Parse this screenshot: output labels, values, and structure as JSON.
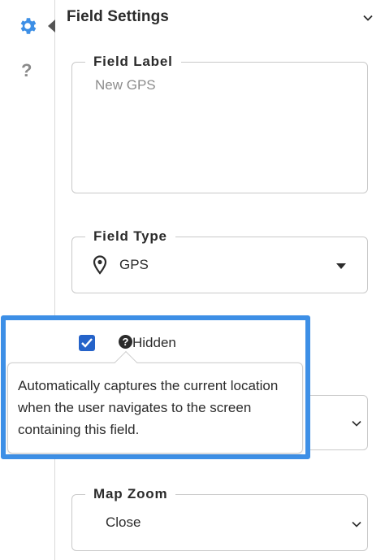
{
  "sidebar": {
    "icons": [
      "gear-icon",
      "help-icon"
    ],
    "help_glyph": "?"
  },
  "panel": {
    "title": "Field Settings",
    "accent_color": "#3d8fe6",
    "checkbox_color": "#2563c9"
  },
  "fields": {
    "label": {
      "legend": "Field Label",
      "value": "New GPS"
    },
    "type": {
      "legend": "Field Type",
      "value": "GPS",
      "icon": "map-pin-icon"
    },
    "map_zoom": {
      "legend": "Map Zoom",
      "value": "Close"
    }
  },
  "hidden_option": {
    "checked": true,
    "help_glyph": "?",
    "label": "Hidden",
    "tooltip": "Automatically captures the current location when the user navigates to the screen containing this field."
  }
}
